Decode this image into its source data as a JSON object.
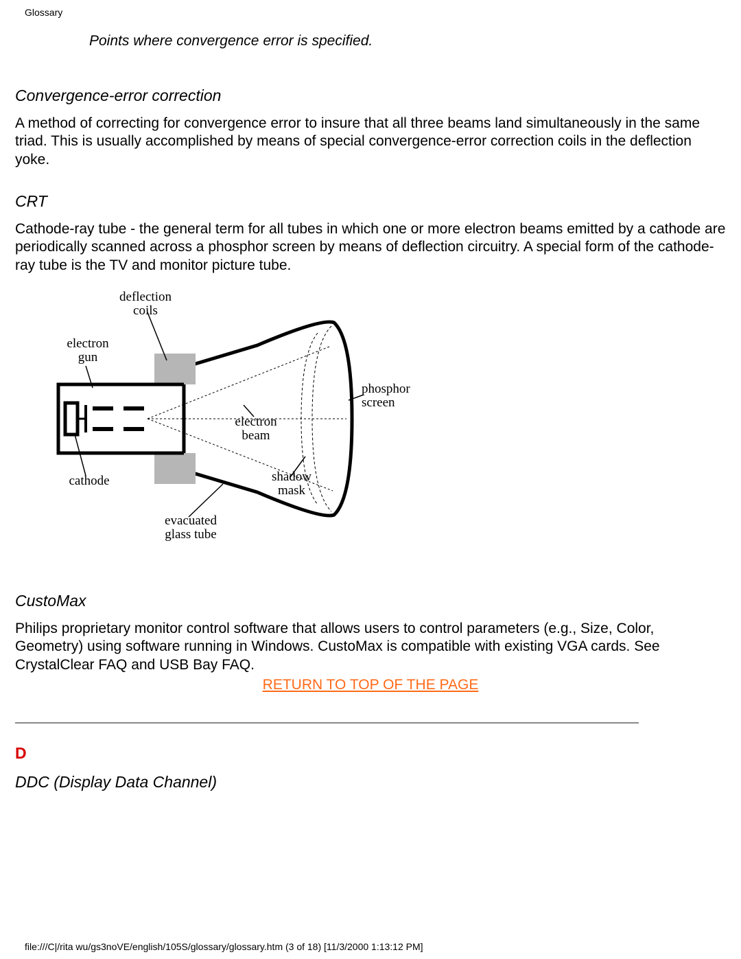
{
  "header": {
    "title": "Glossary"
  },
  "caption": "Points where convergence error is specified.",
  "entries": {
    "convergence_correction": {
      "heading": "Convergence-error correction",
      "body": "A method of correcting for convergence error to insure that all three beams land simultaneously in the same triad. This is usually accomplished by means of special convergence-error correction coils in the deflection yoke."
    },
    "crt": {
      "heading": "CRT",
      "body": "Cathode-ray tube - the general term for all tubes in which one or more electron beams emitted by a cathode are periodically scanned across a phosphor screen by means of deflection circuitry. A special form of the cathode-ray tube is the TV and monitor picture tube."
    },
    "customax": {
      "heading": "CustoMax",
      "body": "Philips proprietary monitor control software that allows users to control parameters (e.g., Size, Color, Geometry) using software running in Windows. CustoMax is compatible with existing VGA cards. See CrystalClear FAQ and USB Bay FAQ."
    },
    "ddc": {
      "heading": "DDC (Display Data Channel)"
    }
  },
  "diagram_labels": {
    "deflection_coils_1": "deflection",
    "deflection_coils_2": "coils",
    "electron_gun_1": "electron",
    "electron_gun_2": "gun",
    "phosphor_screen_1": "phosphor",
    "phosphor_screen_2": "screen",
    "electron_beam_1": "electron",
    "electron_beam_2": "beam",
    "cathode": "cathode",
    "shadow_mask_1": "shadow",
    "shadow_mask_2": "mask",
    "evacuated_1": "evacuated",
    "evacuated_2": "glass tube"
  },
  "return_link": "RETURN TO TOP OF THE PAGE",
  "section_letter": "D",
  "footer": "file:///C|/rita wu/gs3noVE/english/105S/glossary/glossary.htm (3 of 18) [11/3/2000 1:13:12 PM]"
}
